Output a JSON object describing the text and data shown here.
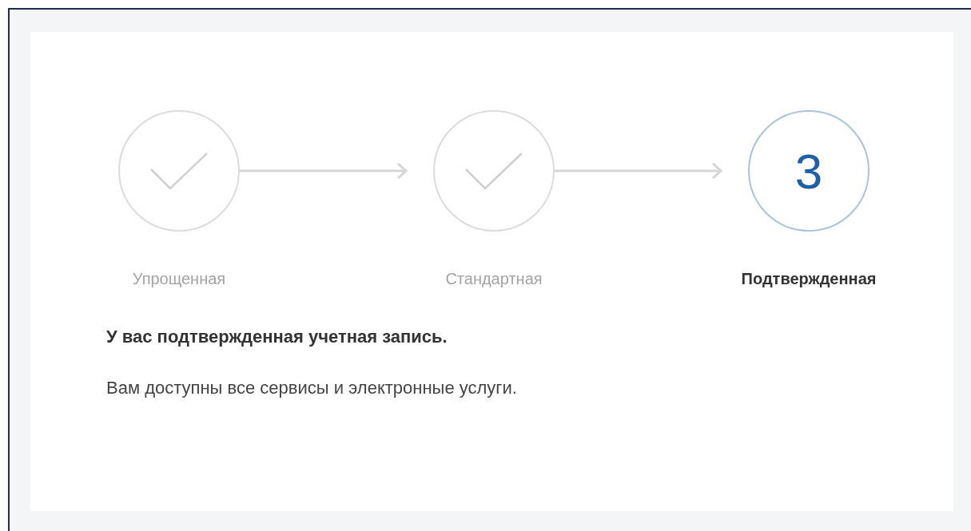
{
  "steps": [
    {
      "label": "Упрощенная",
      "done": true
    },
    {
      "label": "Стандартная",
      "done": true
    },
    {
      "label": "Подтвержденная",
      "done": false,
      "number": "3"
    }
  ],
  "heading": "У вас подтвержденная учетная запись.",
  "description": "Вам доступны все сервисы и электронные услуги."
}
